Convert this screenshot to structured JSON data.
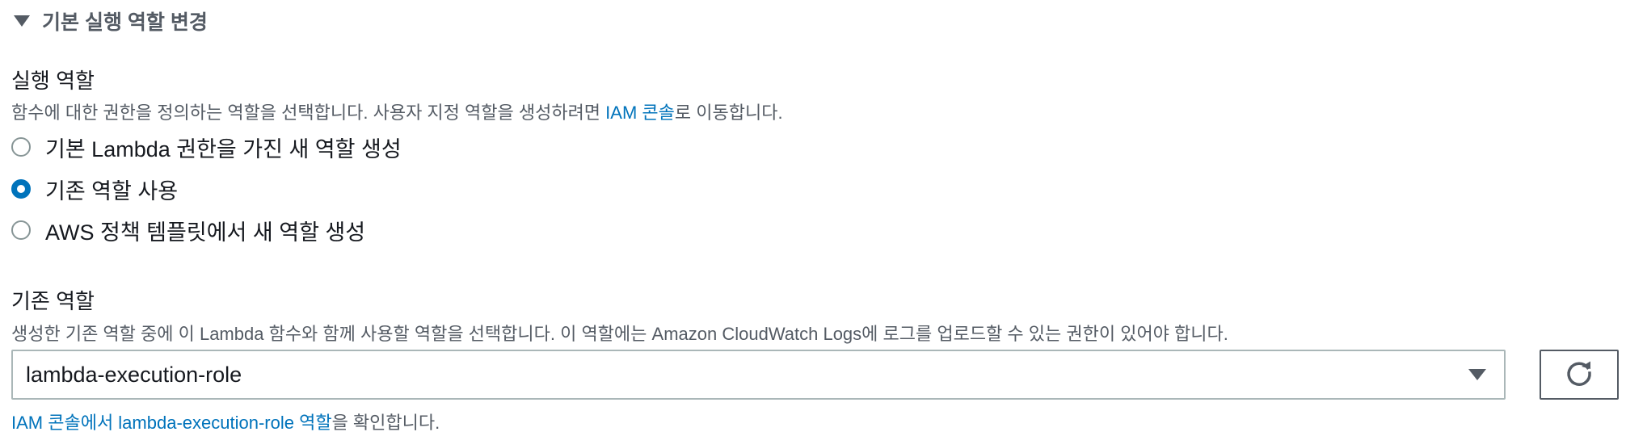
{
  "section": {
    "title": "기본 실행 역할 변경"
  },
  "execution_role": {
    "label": "실행 역할",
    "description_prefix": "함수에 대한 권한을 정의하는 역할을 선택합니다. 사용자 지정 역할을 생성하려면 ",
    "description_link": "IAM 콘솔",
    "description_suffix": "로 이동합니다.",
    "options": [
      {
        "label": "기본 Lambda 권한을 가진 새 역할 생성",
        "selected": false
      },
      {
        "label": "기존 역할 사용",
        "selected": true
      },
      {
        "label": "AWS 정책 템플릿에서 새 역할 생성",
        "selected": false
      }
    ]
  },
  "existing_role": {
    "label": "기존 역할",
    "description": "생성한 기존 역할 중에 이 Lambda 함수와 함께 사용할 역할을 선택합니다. 이 역할에는 Amazon CloudWatch Logs에 로그를 업로드할 수 있는 권한이 있어야 합니다.",
    "selected_value": "lambda-execution-role",
    "footer_link": "IAM 콘솔에서 lambda-execution-role 역할",
    "footer_suffix": "을 확인합니다."
  },
  "icons": {
    "section_caret": "caret-down-icon",
    "select_caret": "caret-down-icon",
    "refresh": "refresh-icon"
  },
  "colors": {
    "link": "#0073bb",
    "radio_selected": "#0073bb",
    "text": "#16191f",
    "muted_text": "#545b64"
  }
}
